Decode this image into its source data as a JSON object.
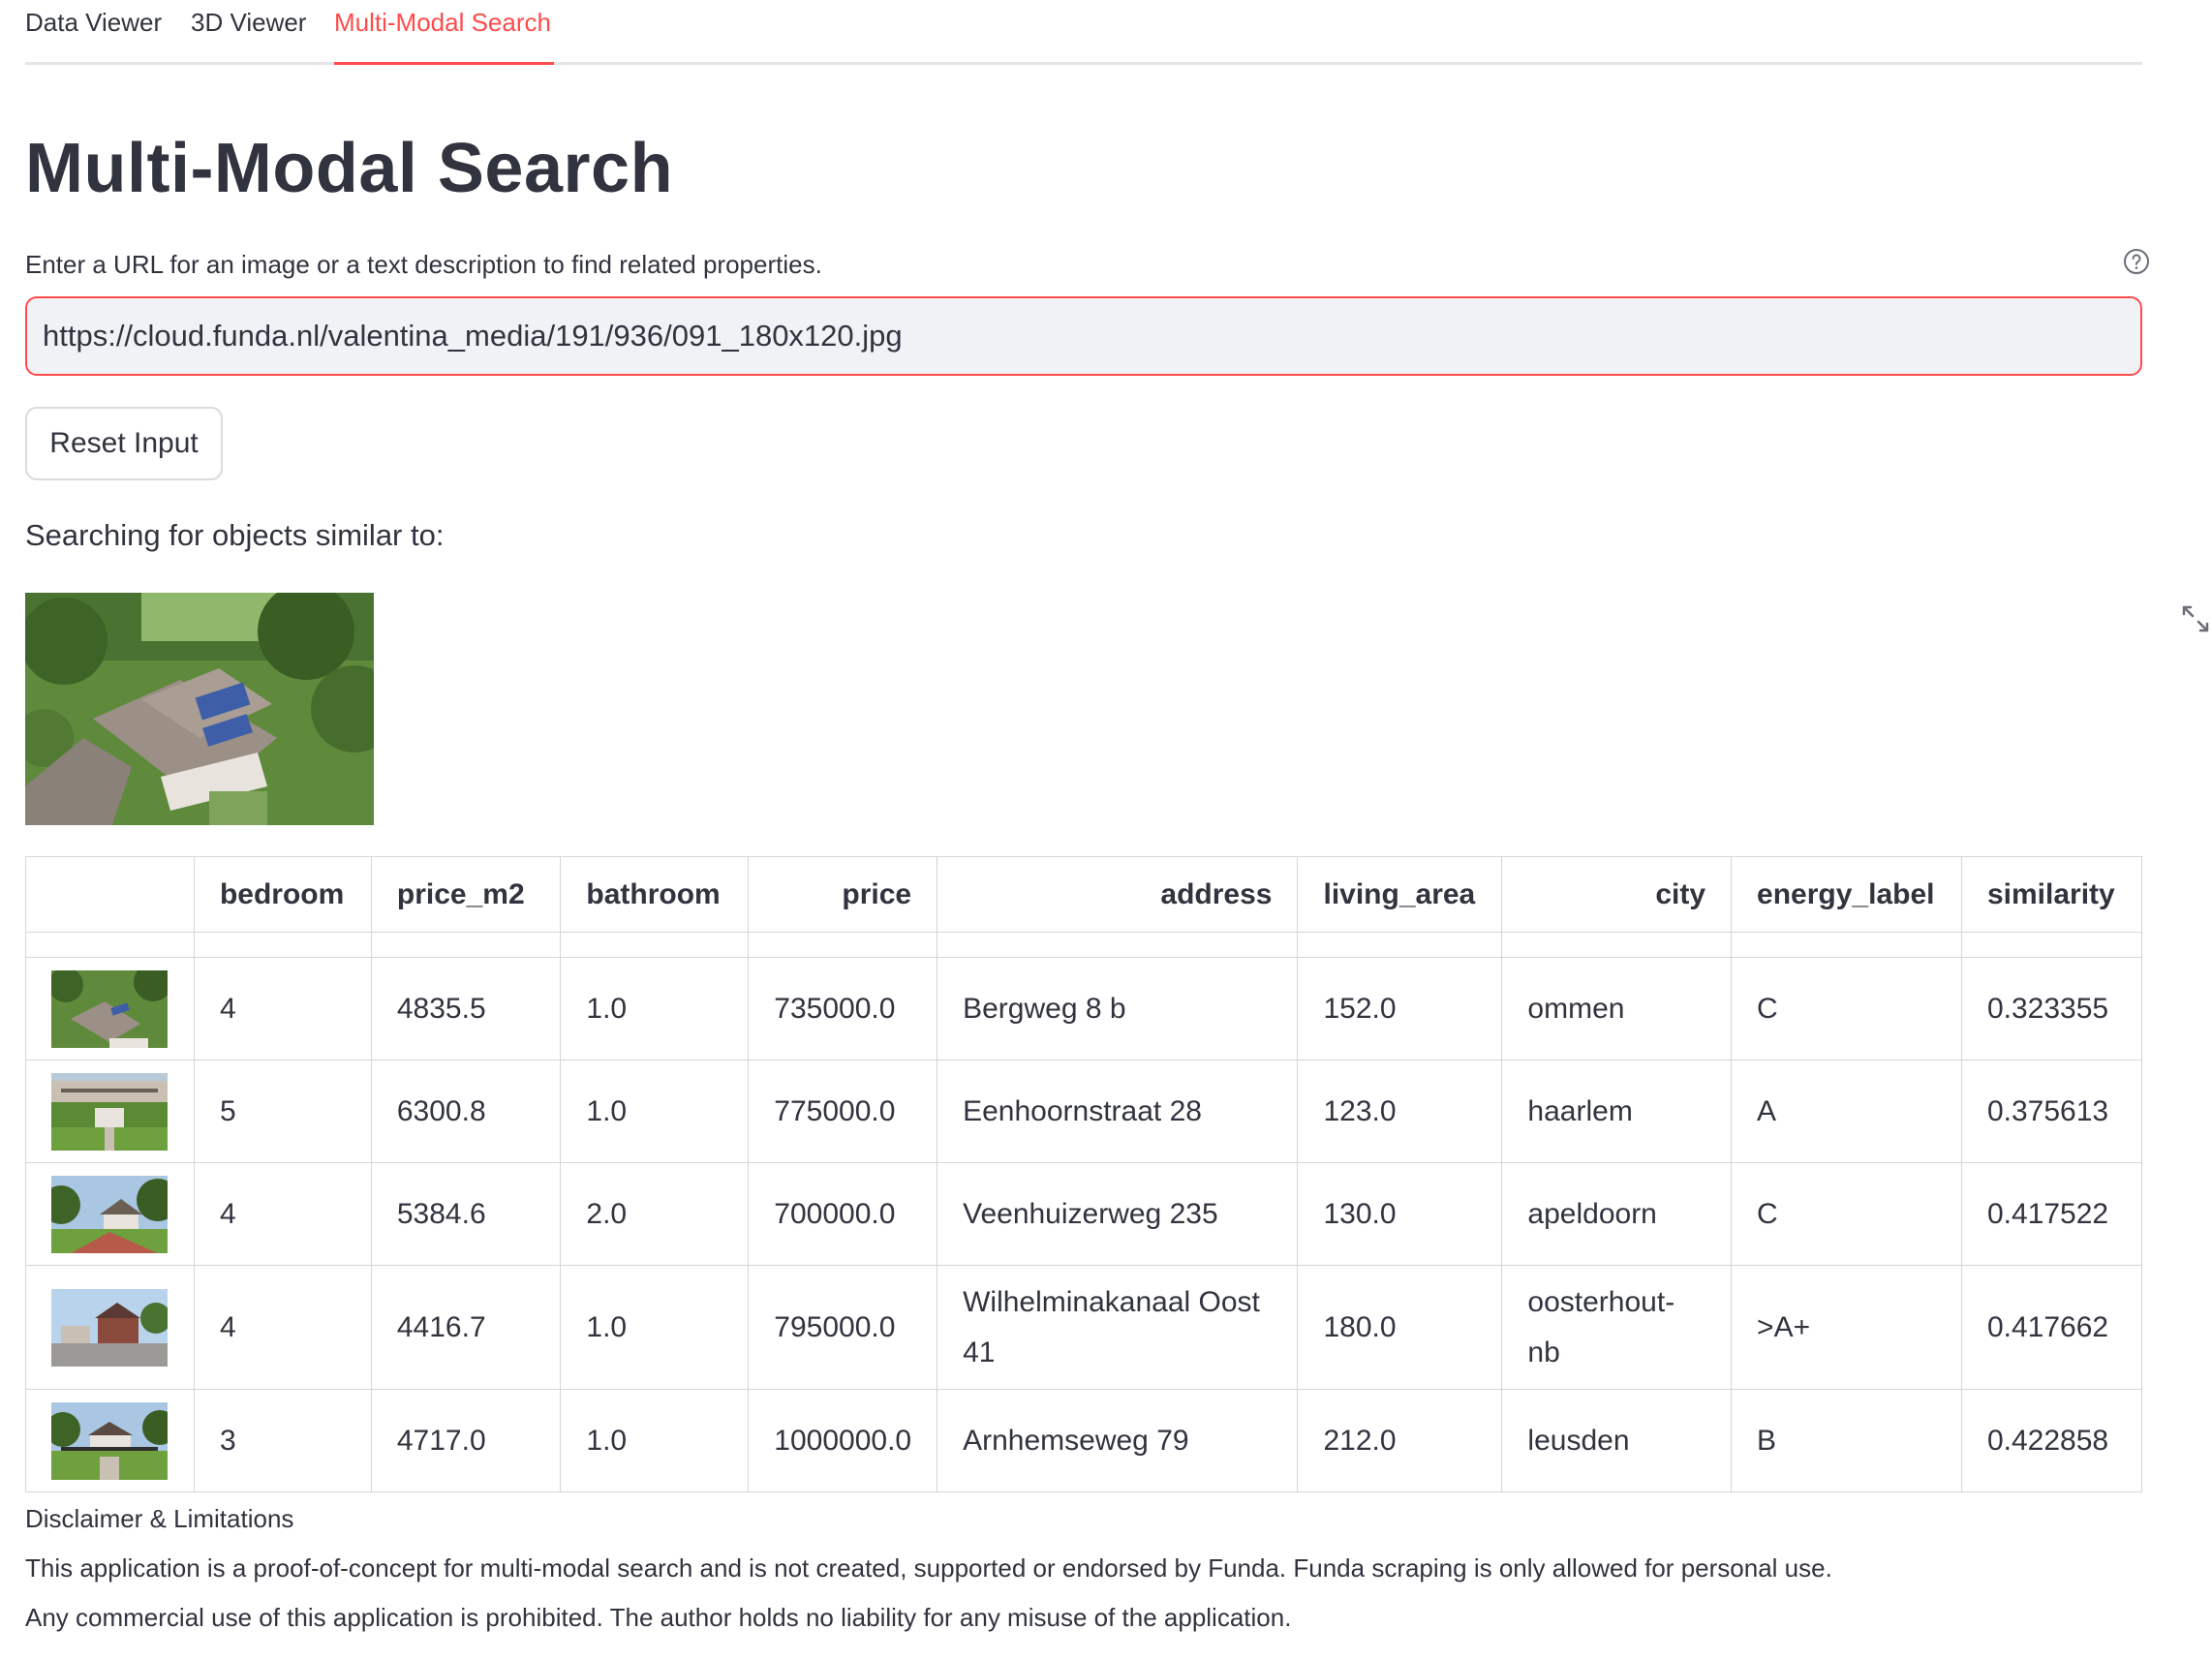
{
  "tabs": [
    {
      "label": "Data Viewer",
      "active": false
    },
    {
      "label": "3D Viewer",
      "active": false
    },
    {
      "label": "Multi-Modal Search",
      "active": true
    }
  ],
  "colors": {
    "accent": "#ff4b4b",
    "text": "#31333F",
    "input_bg": "#f0f2f6",
    "border": "#d6d6da"
  },
  "page": {
    "title": "Multi-Modal Search",
    "input_label": "Enter a URL for an image or a text description to find related properties.",
    "help_icon": "question-circle-icon"
  },
  "search": {
    "value": "https://cloud.funda.nl/valentina_media/191/936/091_180x120.jpg",
    "placeholder": ""
  },
  "reset_button": {
    "label": "Reset Input"
  },
  "query": {
    "searching_text": "Searching for objects similar to:",
    "image_icon": "aerial-house-photo"
  },
  "expand_icon": "fullscreen-expand-icon",
  "table": {
    "columns": [
      "",
      "bedroom",
      "price_m2",
      "bathroom",
      "price",
      "address",
      "living_area",
      "city",
      "energy_label",
      "similarity"
    ],
    "rows": [
      {
        "thumb": "house-photo-aerial",
        "bedroom": "4",
        "price_m2": "4835.5",
        "bathroom": "1.0",
        "price": "735000.0",
        "address": "Bergweg 8 b",
        "living_area": "152.0",
        "city": "ommen",
        "energy_label": "C",
        "similarity": "0.323355"
      },
      {
        "thumb": "house-photo-garden",
        "bedroom": "5",
        "price_m2": "6300.8",
        "bathroom": "1.0",
        "price": "775000.0",
        "address": "Eenhoornstraat 28",
        "living_area": "123.0",
        "city": "haarlem",
        "energy_label": "A",
        "similarity": "0.375613"
      },
      {
        "thumb": "house-photo-driveway",
        "bedroom": "4",
        "price_m2": "5384.6",
        "bathroom": "2.0",
        "price": "700000.0",
        "address": "Veenhuizerweg 235",
        "living_area": "130.0",
        "city": "apeldoorn",
        "energy_label": "C",
        "similarity": "0.417522"
      },
      {
        "thumb": "house-photo-street",
        "bedroom": "4",
        "price_m2": "4416.7",
        "bathroom": "1.0",
        "price": "795000.0",
        "address_line1": "Wilhelminakanaal Oost",
        "address_line2": "41",
        "living_area": "180.0",
        "city_line1": "oosterhout-",
        "city_line2": "nb",
        "energy_label": ">A+",
        "similarity": "0.417662"
      },
      {
        "thumb": "house-photo-gate",
        "bedroom": "3",
        "price_m2": "4717.0",
        "bathroom": "1.0",
        "price": "1000000.0",
        "address": "Arnhemseweg 79",
        "living_area": "212.0",
        "city": "leusden",
        "energy_label": "B",
        "similarity": "0.422858"
      }
    ]
  },
  "disclaimer": {
    "title": "Disclaimer & Limitations",
    "line1": "This application is a proof-of-concept for multi-modal search and is not created, supported or endorsed by Funda. Funda scraping is only allowed for personal use.",
    "line2": "Any commercial use of this application is prohibited. The author holds no liability for any misuse of the application."
  }
}
